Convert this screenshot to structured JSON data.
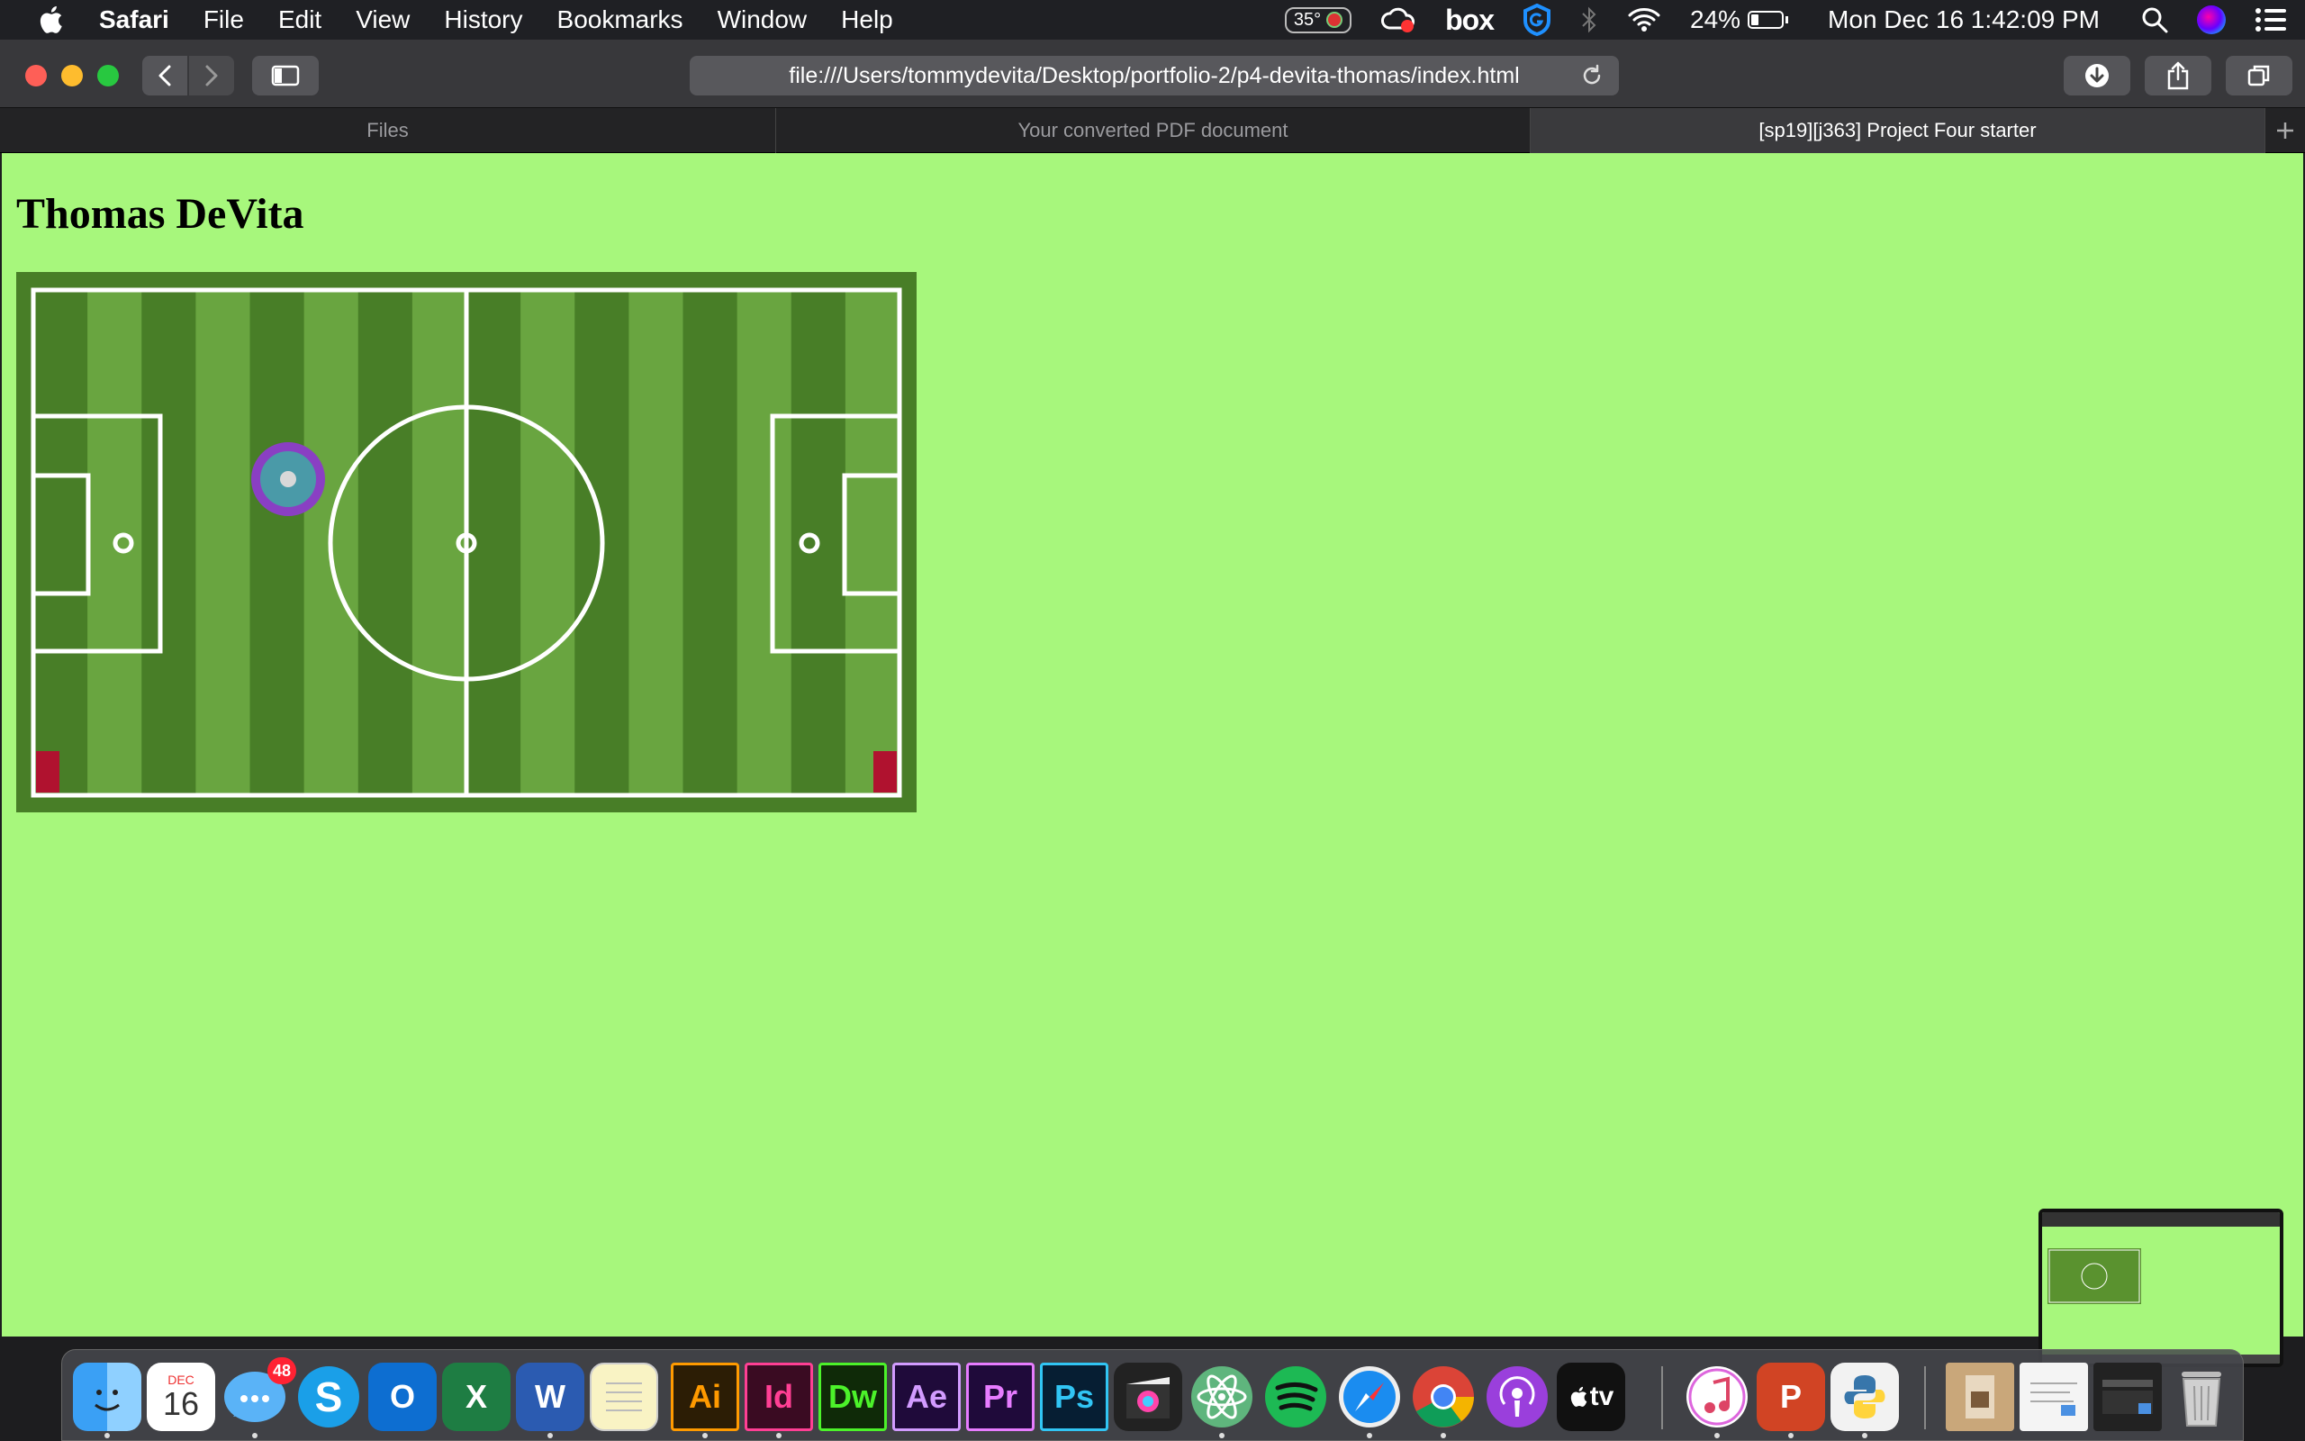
{
  "menubar": {
    "app_name": "Safari",
    "items": [
      "File",
      "Edit",
      "View",
      "History",
      "Bookmarks",
      "Window",
      "Help"
    ],
    "temperature": "35°",
    "box_label": "box",
    "battery_percent": "24%",
    "battery_level": 0.24,
    "datetime": "Mon Dec 16  1:42:09 PM"
  },
  "browser": {
    "url": "file:///Users/tommydevita/Desktop/portfolio-2/p4-devita-thomas/index.html",
    "tabs": [
      {
        "label": "Files",
        "active": false
      },
      {
        "label": "Your converted PDF document",
        "active": false
      },
      {
        "label": "[sp19][j363] Project Four starter",
        "active": true
      }
    ]
  },
  "page": {
    "background": "#a7f77c",
    "heading": "Thomas DeVita",
    "pitch": {
      "grass_light": "#69a540",
      "grass_dark": "#487e27",
      "line_color": "#ffffff",
      "goal_color": "#b0122f",
      "ball_ring": "#8a3fc3",
      "ball_fill": "#4a9aa8"
    }
  },
  "dock": {
    "calendar_month": "DEC",
    "calendar_day": "16",
    "messages_badge": "48",
    "apps": [
      "finder-icon",
      "calendar-icon",
      "messages-icon",
      "skype-icon",
      "outlook-icon",
      "excel-icon",
      "word-icon",
      "notes-icon",
      "illustrator-icon",
      "indesign-icon",
      "dreamweaver-icon",
      "after-effects-icon",
      "premiere-icon",
      "photoshop-icon",
      "final-cut-icon",
      "atom-icon",
      "spotify-icon",
      "safari-icon",
      "chrome-icon",
      "podcasts-icon",
      "apple-tv-icon",
      "itunes-icon",
      "powerpoint-icon",
      "python-icon"
    ],
    "labels": {
      "ai": "Ai",
      "id": "Id",
      "dw": "Dw",
      "ae": "Ae",
      "pr": "Pr",
      "ps": "Ps",
      "tv": "tv",
      "outlook": "O",
      "excel": "X",
      "word": "W",
      "ppt": "P"
    }
  }
}
